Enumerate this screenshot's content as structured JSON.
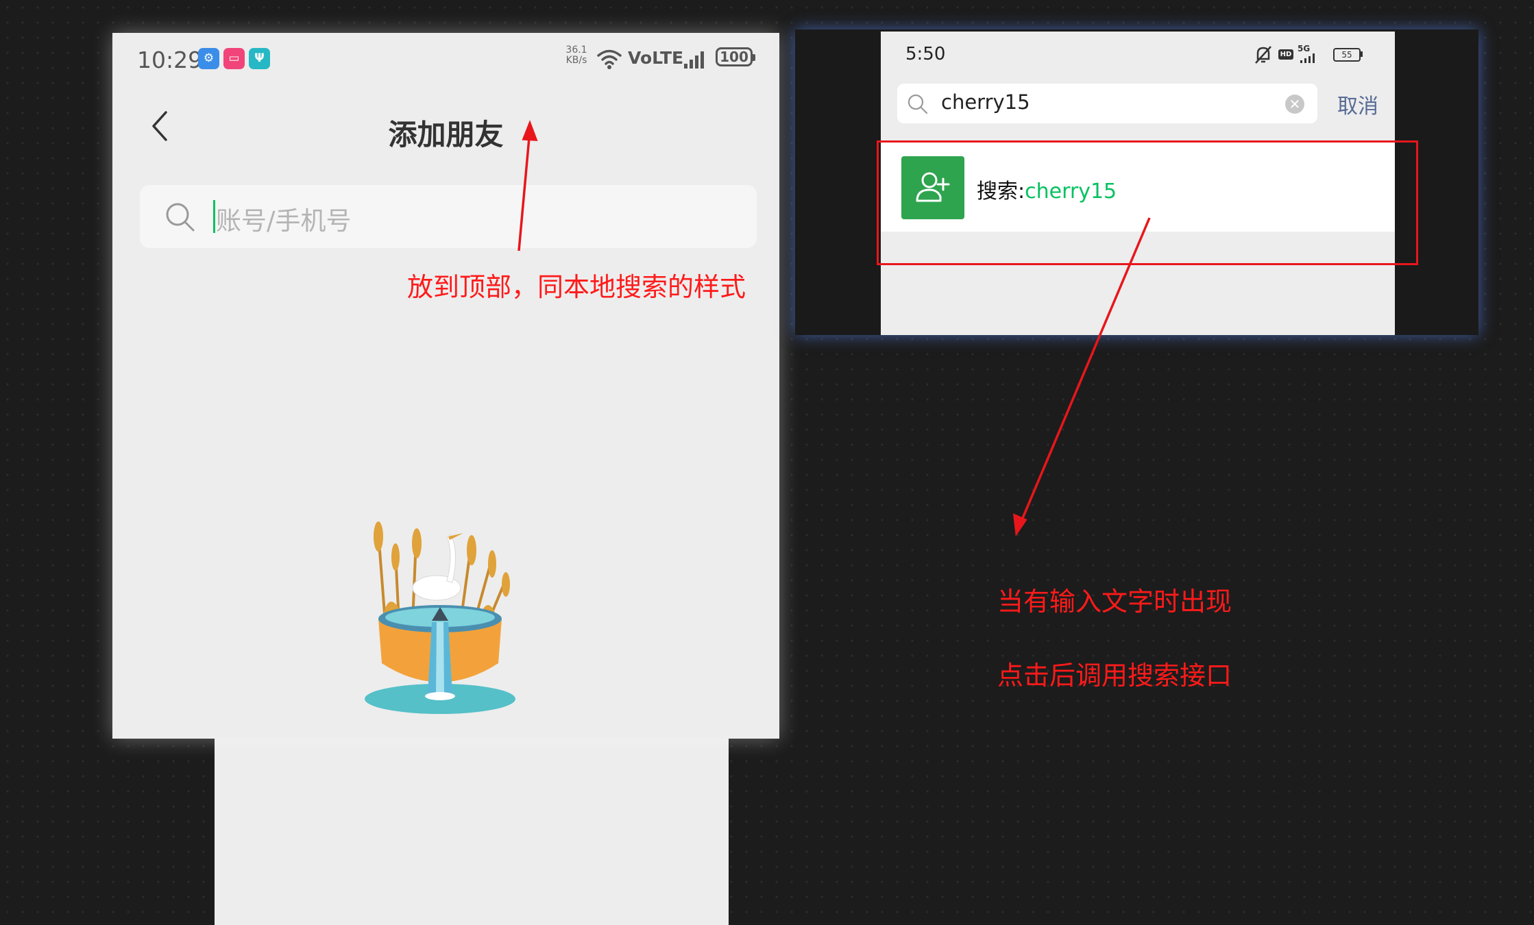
{
  "left_phone": {
    "status_bar": {
      "time": "10:29",
      "network_speed_value": "36.1",
      "network_speed_unit": "KB/s",
      "network_label": "VoLTE",
      "battery": "100"
    },
    "title": "添加朋友",
    "search": {
      "placeholder": "账号/手机号"
    }
  },
  "right_phone": {
    "status_bar": {
      "time": "5:50",
      "network_label": "5G",
      "hd_label": "HD",
      "battery": "55"
    },
    "search": {
      "value": "cherry15",
      "cancel_label": "取消"
    },
    "result": {
      "prefix": "搜索:",
      "query": "cherry15"
    }
  },
  "annotations": {
    "top_note": "放到顶部，同本地搜索的样式",
    "right_note_1": "当有输入文字时出现",
    "right_note_2": "点击后调用搜索接口"
  },
  "colors": {
    "annotation": "#ff1a1a",
    "wechat_green": "#07c160",
    "link_blue": "#576b95",
    "phone_bg": "#ededed"
  }
}
